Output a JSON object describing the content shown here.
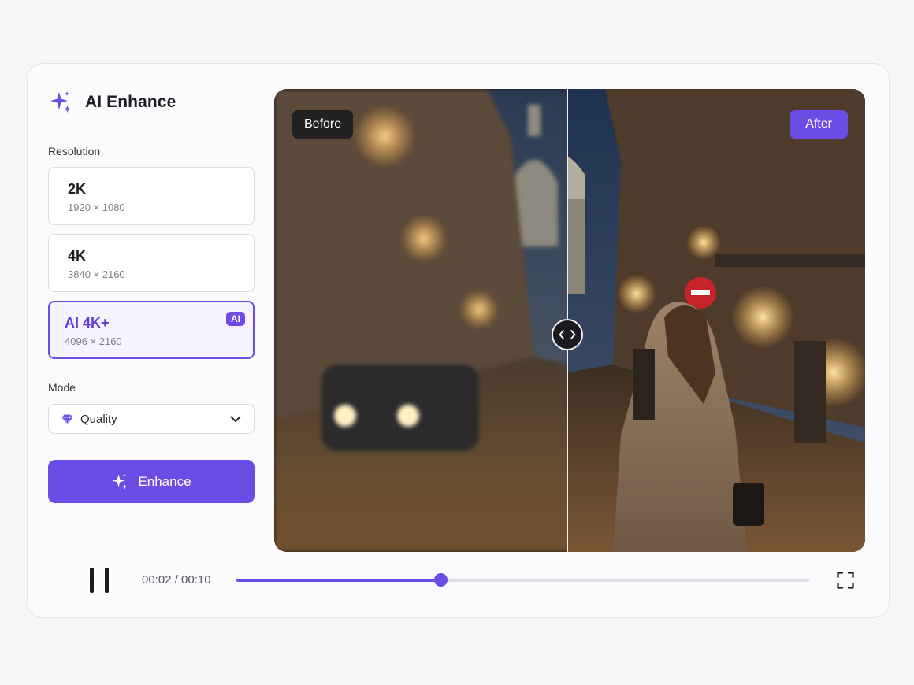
{
  "app": {
    "title": "AI Enhance",
    "accent": "#6b4de6"
  },
  "resolution": {
    "label": "Resolution",
    "options": [
      {
        "name": "2K",
        "dims": "1920 × 1080",
        "selected": false
      },
      {
        "name": "4K",
        "dims": "3840 × 2160",
        "selected": false
      },
      {
        "name": "AI 4K+",
        "dims": "4096 × 2160",
        "badge": "AI",
        "selected": true
      }
    ]
  },
  "mode": {
    "label": "Mode",
    "value": "Quality",
    "icon": "diamond-icon"
  },
  "actions": {
    "enhance_label": "Enhance",
    "enhance_icon": "sparkle-icon"
  },
  "viewer": {
    "before_label": "Before",
    "after_label": "After",
    "handle_icon": "compare-arrows-icon"
  },
  "playback": {
    "time": "00:02 / 00:10",
    "progress": 0.356,
    "state": "playing"
  }
}
